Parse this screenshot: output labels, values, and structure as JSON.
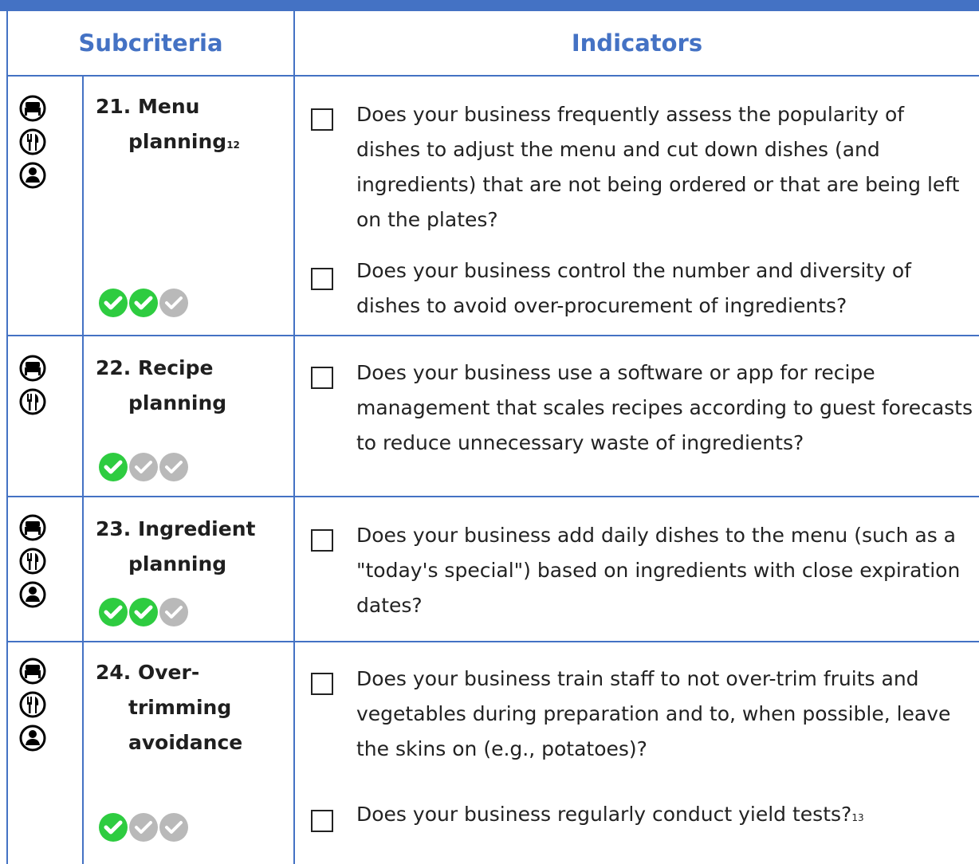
{
  "header": {
    "subcriteria": "Subcriteria",
    "indicators": "Indicators"
  },
  "rows": [
    {
      "title_1": "21. Menu",
      "title_2": "planning",
      "title_sup": "12",
      "icons": [
        "hotel-bed-icon",
        "restaurant-cutlery-icon",
        "person-icon"
      ],
      "rating": {
        "filled": 2,
        "total": 3
      },
      "indicators": [
        {
          "text": "Does your business frequently assess the popularity of dishes to adjust the menu and cut down dishes (and ingredients) that are not being ordered or that are being left on the plates?",
          "checked": false
        },
        {
          "text": "Does your business control the number and diversity of dishes to avoid over-procurement of ingredients?",
          "checked": false
        }
      ]
    },
    {
      "title_1": "22. Recipe",
      "title_2": "planning",
      "title_sup": "",
      "icons": [
        "hotel-bed-icon",
        "restaurant-cutlery-icon"
      ],
      "rating": {
        "filled": 1,
        "total": 3
      },
      "indicators": [
        {
          "text": "Does your business use a software or app for recipe management that scales recipes according to guest forecasts to reduce unnecessary waste of ingredients?",
          "checked": false
        }
      ]
    },
    {
      "title_1": "23. Ingredient",
      "title_2": "planning",
      "title_sup": "",
      "icons": [
        "hotel-bed-icon",
        "restaurant-cutlery-icon",
        "person-icon"
      ],
      "rating": {
        "filled": 2,
        "total": 3
      },
      "indicators": [
        {
          "text": "Does your business add daily dishes to the menu (such as a \"today's special\") based on ingredients with close expiration dates?",
          "checked": false
        }
      ]
    },
    {
      "title_1": "24. Over-",
      "title_2": "trimming",
      "title_3": "avoidance",
      "title_sup": "",
      "icons": [
        "hotel-bed-icon",
        "restaurant-cutlery-icon",
        "person-icon"
      ],
      "rating": {
        "filled": 1,
        "total": 3
      },
      "indicators": [
        {
          "text": "Does your business train staff to not over-trim fruits and vegetables during preparation and to, when possible, leave the skins on (e.g., potatoes)?",
          "checked": false
        },
        {
          "text": "Does your business regularly conduct yield tests?",
          "sup": "13",
          "checked": false
        }
      ]
    }
  ],
  "colors": {
    "accent": "#4472c4",
    "check_on": "#2ecc40",
    "check_off": "#b9b9b9"
  }
}
